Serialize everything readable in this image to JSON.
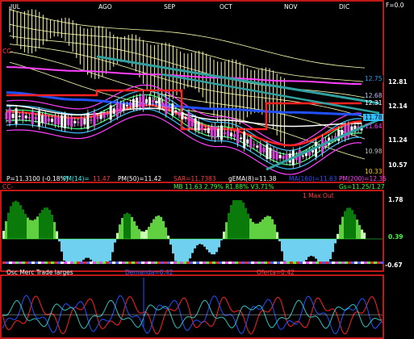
{
  "corner_label": "F=0.0",
  "main_panel": {
    "x_tick_labels": [
      "JUL",
      "AGO",
      "SEP",
      "OCT",
      "NOV",
      "DIC"
    ],
    "y_tick_labels": [
      "12.81",
      "12.14",
      "11.24",
      "10.57"
    ],
    "price_tags": [
      {
        "text": "12.75",
        "color": "#2aa0ff"
      },
      {
        "text": "12.68",
        "color": "#c0c0ff"
      },
      {
        "text": "12.31",
        "color": "#ffffff"
      },
      {
        "text": "11.78",
        "color": "#30c0ff"
      },
      {
        "text": "11.64",
        "color": "#ff40ff"
      },
      {
        "text": "10.98",
        "color": "#c0c0c0"
      },
      {
        "text": "10.33",
        "color": "#ffd000"
      }
    ],
    "cc_label": "CC-",
    "stats_row1": [
      {
        "text": "P=11.3100 (-0.18%)",
        "color": "#ffffff"
      },
      {
        "text": "PM(14)=",
        "color": "#30ffff"
      },
      {
        "text": "11.47",
        "color": "#ff4040"
      },
      {
        "text": "PM(50)=11.42",
        "color": "#ffffff"
      },
      {
        "text": "SAR=11.7383",
        "color": "#ff4040"
      },
      {
        "text": "gEMA(8)=11.38",
        "color": "#ffffff"
      },
      {
        "text": "MA(160)=11.63",
        "color": "#3050ff"
      },
      {
        "text": "PM(200)=12.35",
        "color": "#ff40ff"
      }
    ],
    "stats_row2": [
      {
        "text": "MB 11.63 2.79% R1.88% V3.71%",
        "color": "#40ff40"
      },
      {
        "text": "Gs=11.25/1.27",
        "color": "#40ff40"
      }
    ],
    "cc_label_2": "CC-"
  },
  "middle_panel": {
    "title": "1 Max Out",
    "y_tick_labels": [
      "1.78",
      "0.39",
      "-0.67"
    ]
  },
  "bottom_panel": {
    "title": "Osc Merc Trade larges",
    "label_demanda": "Demanda=0.42",
    "label_oferta": "Oferta=0.42"
  },
  "colors": {
    "frame": "#ff2020",
    "ichimoku_cloud": "#ffffb0",
    "dark_green": "#0a7a0a",
    "mid_green": "#60d040",
    "light_green": "#c8ffb0",
    "cyan_area": "#70d0f0",
    "red_line": "#ff2020",
    "blue_line": "#2050ff",
    "teal_line": "#30a0a0"
  },
  "chart_data": {
    "type": "line",
    "title": "",
    "xlabel": "",
    "ylabel": "",
    "categories": [
      "JUL",
      "AGO",
      "SEP",
      "OCT",
      "NOV",
      "DIC"
    ],
    "ylim": [
      10.33,
      12.81
    ],
    "series": [
      {
        "name": "PM(200)",
        "values": [
          12.75,
          12.66,
          12.58,
          12.5,
          12.42,
          12.35
        ]
      },
      {
        "name": "MA(160)",
        "values": [
          12.15,
          11.98,
          11.86,
          11.76,
          11.68,
          11.63
        ]
      },
      {
        "name": "PM(50)",
        "values": [
          11.85,
          11.62,
          11.78,
          11.5,
          11.35,
          11.42
        ]
      },
      {
        "name": "PM(14)",
        "values": [
          11.7,
          11.55,
          11.85,
          11.3,
          10.9,
          11.47
        ]
      },
      {
        "name": "P",
        "values": [
          11.6,
          11.45,
          11.95,
          11.2,
          10.6,
          11.31
        ]
      }
    ]
  }
}
